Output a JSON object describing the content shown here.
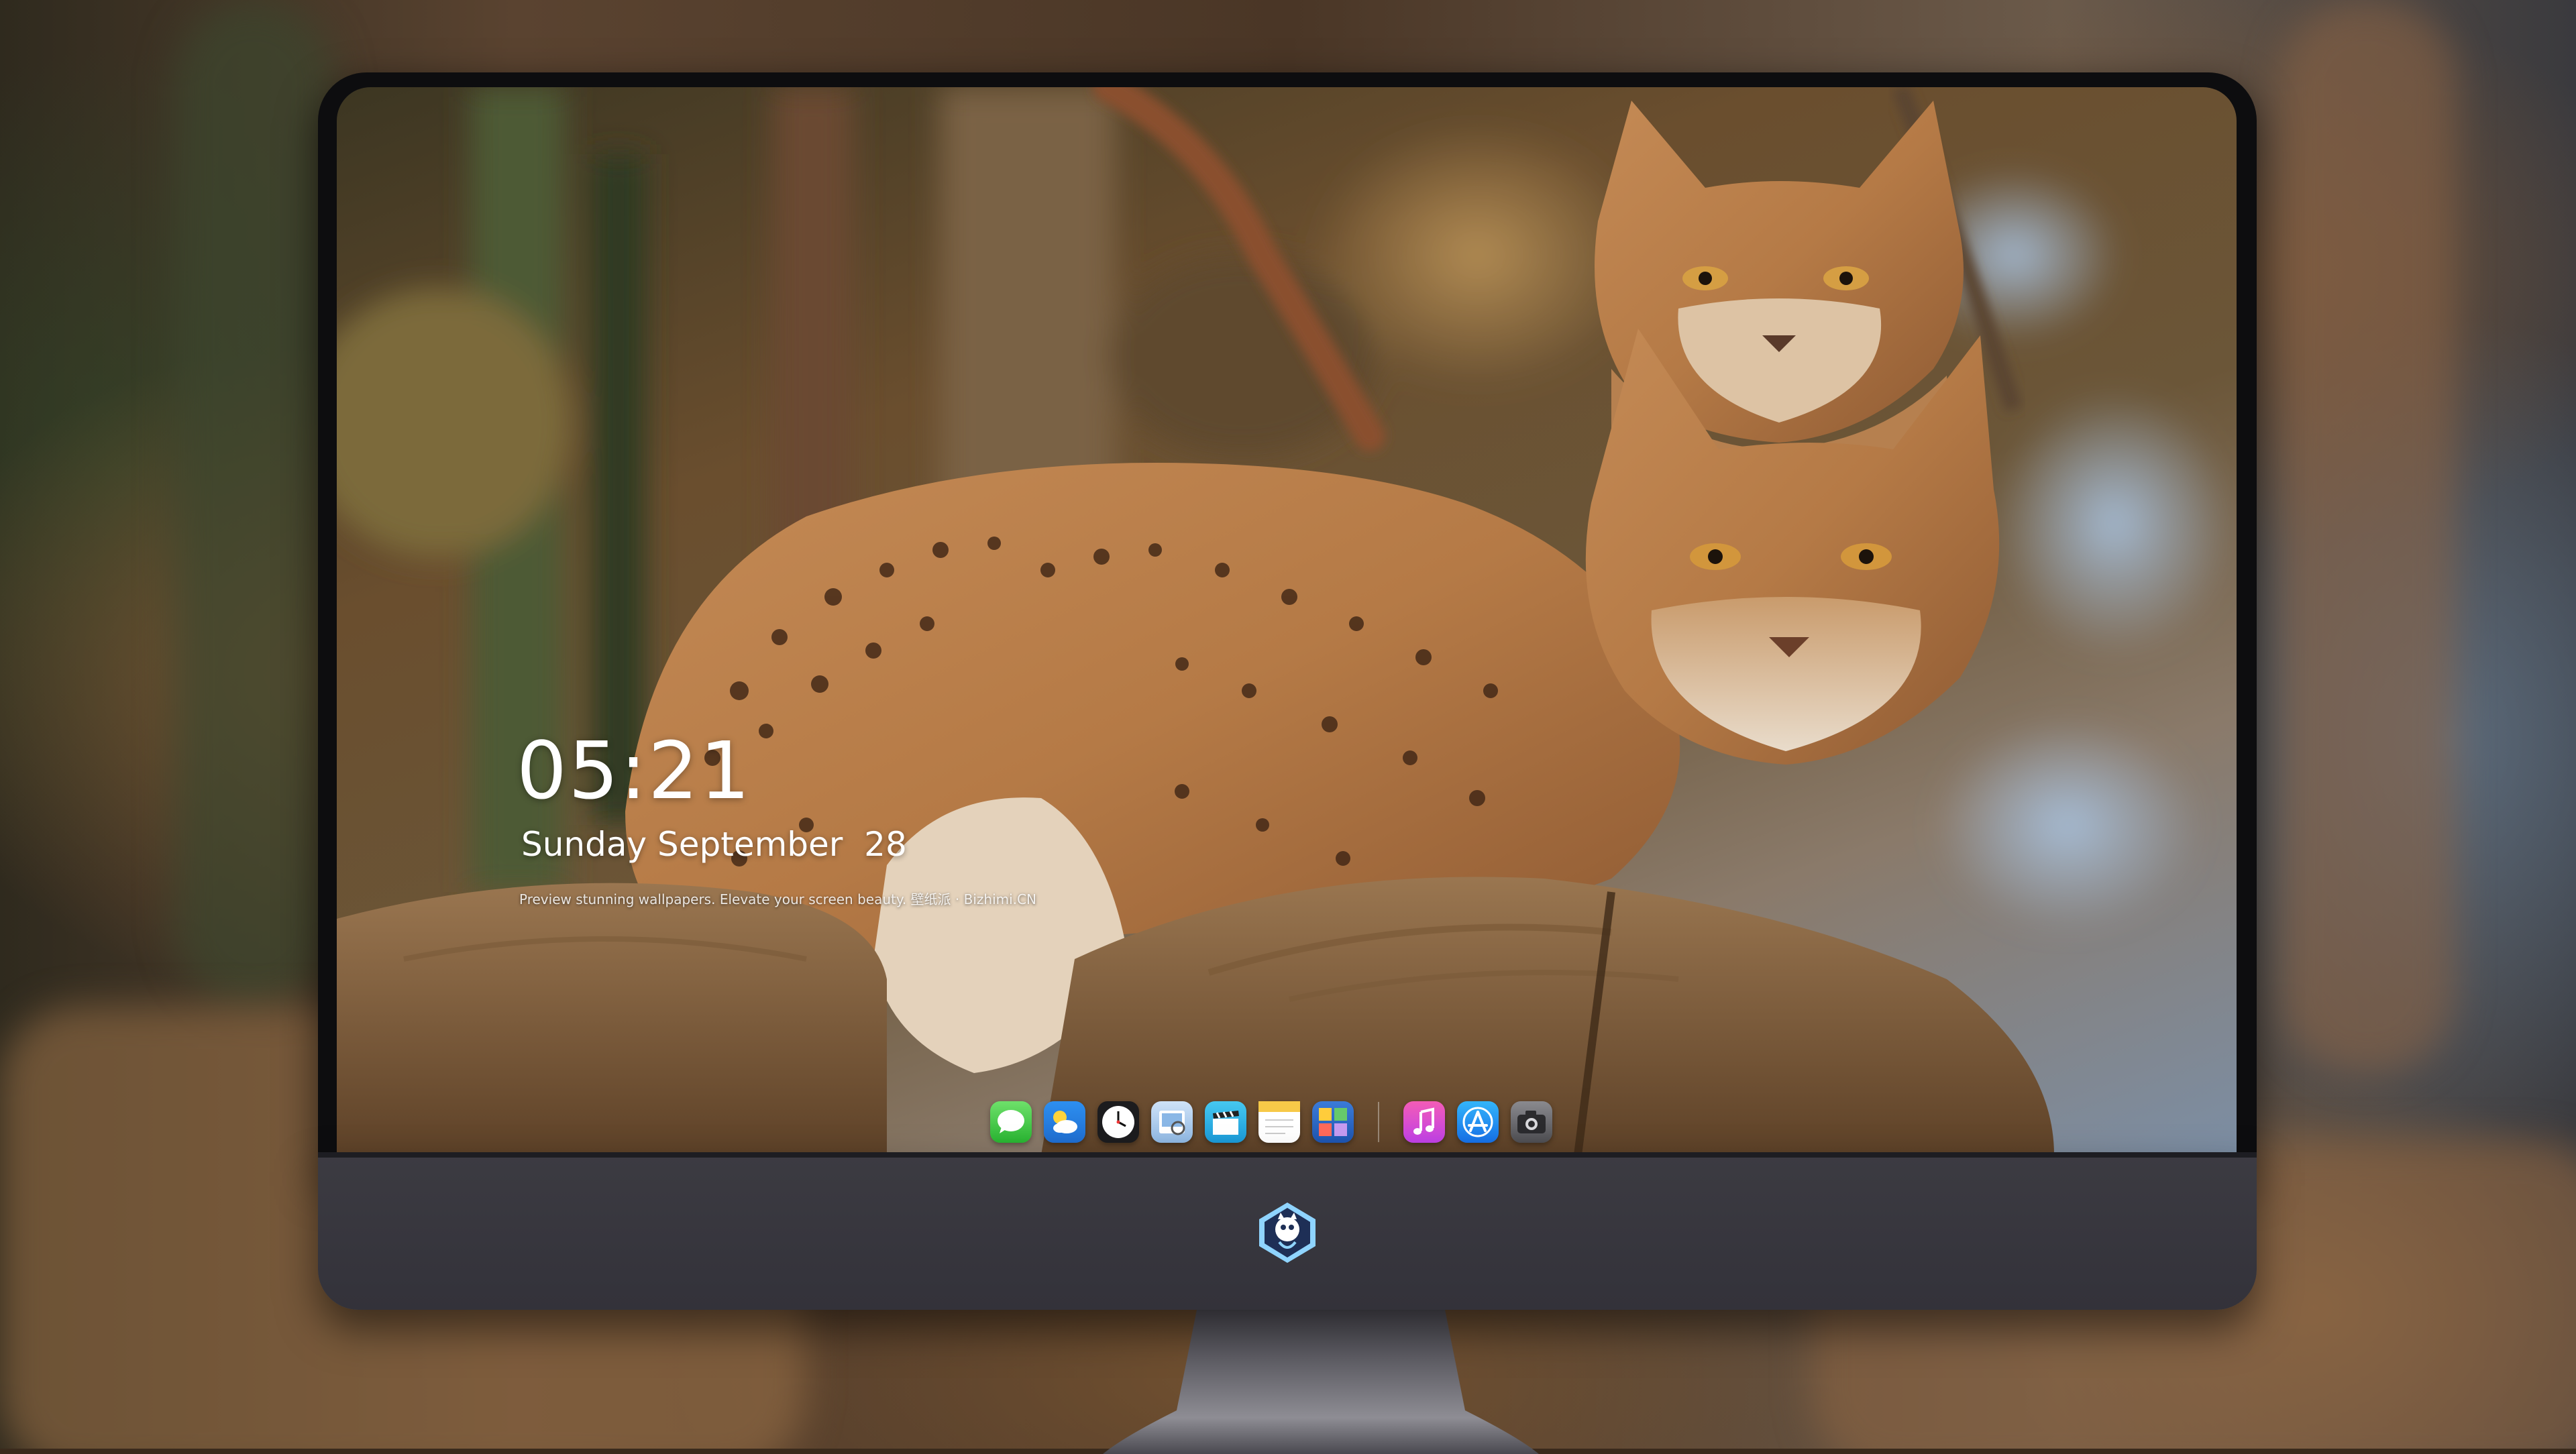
{
  "lockscreen": {
    "time": "05:21",
    "date": "Sunday September  28",
    "caption": "Preview stunning wallpapers. Elevate your screen beauty. 壁纸派 · Bizhimi.CN"
  },
  "dock": {
    "apps": [
      {
        "name": "Messages",
        "icon": "messages-icon"
      },
      {
        "name": "Weather",
        "icon": "weather-icon"
      },
      {
        "name": "Clock",
        "icon": "clock-icon"
      },
      {
        "name": "Preview",
        "icon": "preview-icon"
      },
      {
        "name": "Clips",
        "icon": "clips-icon"
      },
      {
        "name": "Notes",
        "icon": "notes-icon"
      },
      {
        "name": "Photo Booth",
        "icon": "photo-booth-icon"
      },
      {
        "name": "Music",
        "icon": "music-icon"
      },
      {
        "name": "App Store",
        "icon": "app-store-icon"
      },
      {
        "name": "Camera",
        "icon": "camera-icon"
      }
    ]
  },
  "colors": {
    "monitor_chin": "#3c3b42",
    "bezel": "#0d0d0f",
    "lynx_fur": "#b7834f"
  }
}
